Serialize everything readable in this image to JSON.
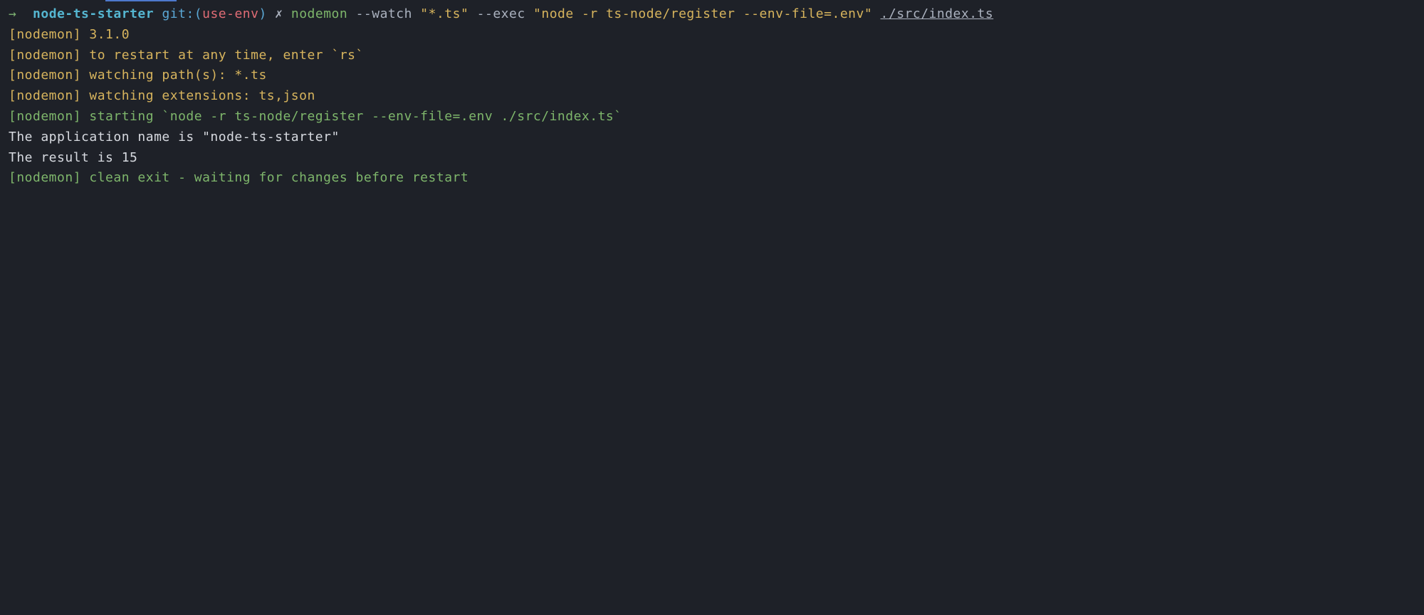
{
  "prompt": {
    "arrow": "→",
    "directory": "node-ts-starter",
    "git_label": "git:(",
    "branch": "use-env",
    "git_close": ")",
    "x_marker": "✗"
  },
  "command": {
    "name": "nodemon",
    "watch_flag": "--watch",
    "watch_value": "\"*.ts\"",
    "exec_flag": "--exec",
    "exec_value": "\"node -r ts-node/register --env-file=.env\"",
    "path": "./src/index.ts"
  },
  "output": {
    "lines": [
      "[nodemon] 3.1.0",
      "[nodemon] to restart at any time, enter `rs`",
      "[nodemon] watching path(s): *.ts",
      "[nodemon] watching extensions: ts,json",
      "[nodemon] starting `node -r ts-node/register --env-file=.env ./src/index.ts`",
      "The application name is \"node-ts-starter\"",
      "The result is 15",
      "[nodemon] clean exit - waiting for changes before restart"
    ]
  }
}
